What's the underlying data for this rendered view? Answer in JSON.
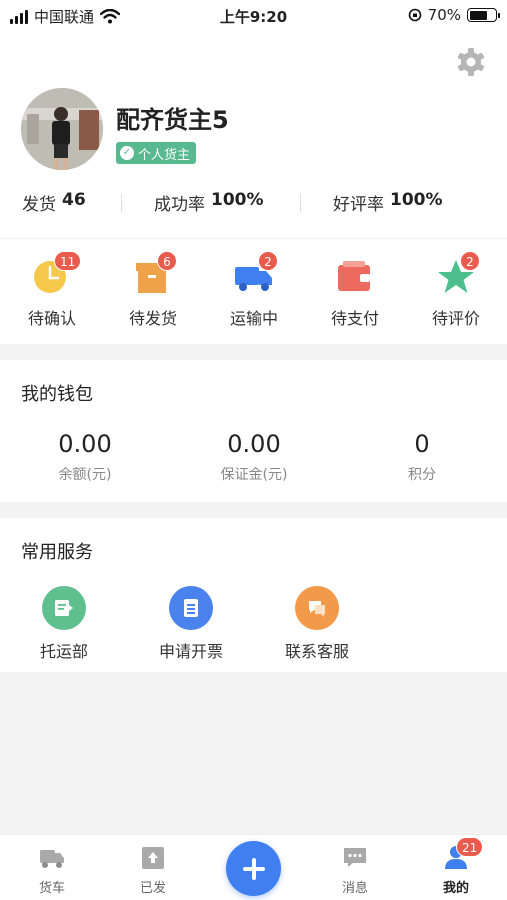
{
  "status_bar": {
    "carrier": "中国联通",
    "time": "上午9:20",
    "battery": "70%",
    "battery_level": 0.7
  },
  "profile": {
    "name": "配齐货主5",
    "badge": "个人货主"
  },
  "stats": [
    {
      "label": "发货",
      "value": "46"
    },
    {
      "label": "成功率",
      "value": "100%"
    },
    {
      "label": "好评率",
      "value": "100%"
    }
  ],
  "orders": [
    {
      "label": "待确认",
      "badge": "11",
      "icon": "clock-icon",
      "color": "#f5c84c"
    },
    {
      "label": "待发货",
      "badge": "6",
      "icon": "box-icon",
      "color": "#f0a24a"
    },
    {
      "label": "运输中",
      "badge": "2",
      "icon": "truck-icon",
      "color": "#3f7ff0"
    },
    {
      "label": "待支付",
      "badge": "",
      "icon": "wallet-icon",
      "color": "#ec6a5e"
    },
    {
      "label": "待评价",
      "badge": "2",
      "icon": "star-icon",
      "color": "#4cbf8c"
    }
  ],
  "wallet": {
    "title": "我的钱包",
    "items": [
      {
        "value": "0.00",
        "label": "余额(元)"
      },
      {
        "value": "0.00",
        "label": "保证金(元)"
      },
      {
        "value": "0",
        "label": "积分"
      }
    ]
  },
  "services": {
    "title": "常用服务",
    "items": [
      {
        "label": "托运部",
        "icon": "consign-icon",
        "color": "#5fbf8f"
      },
      {
        "label": "申请开票",
        "icon": "invoice-icon",
        "color": "#4a82ee"
      },
      {
        "label": "联系客服",
        "icon": "service-chat-icon",
        "color": "#f29a4a"
      }
    ]
  },
  "tabbar": {
    "items": [
      {
        "label": "货车",
        "icon": "truck-icon"
      },
      {
        "label": "已发",
        "icon": "upload-icon"
      },
      {
        "label": "消息",
        "icon": "message-icon"
      },
      {
        "label": "我的",
        "icon": "user-icon",
        "badge": "21"
      }
    ]
  }
}
